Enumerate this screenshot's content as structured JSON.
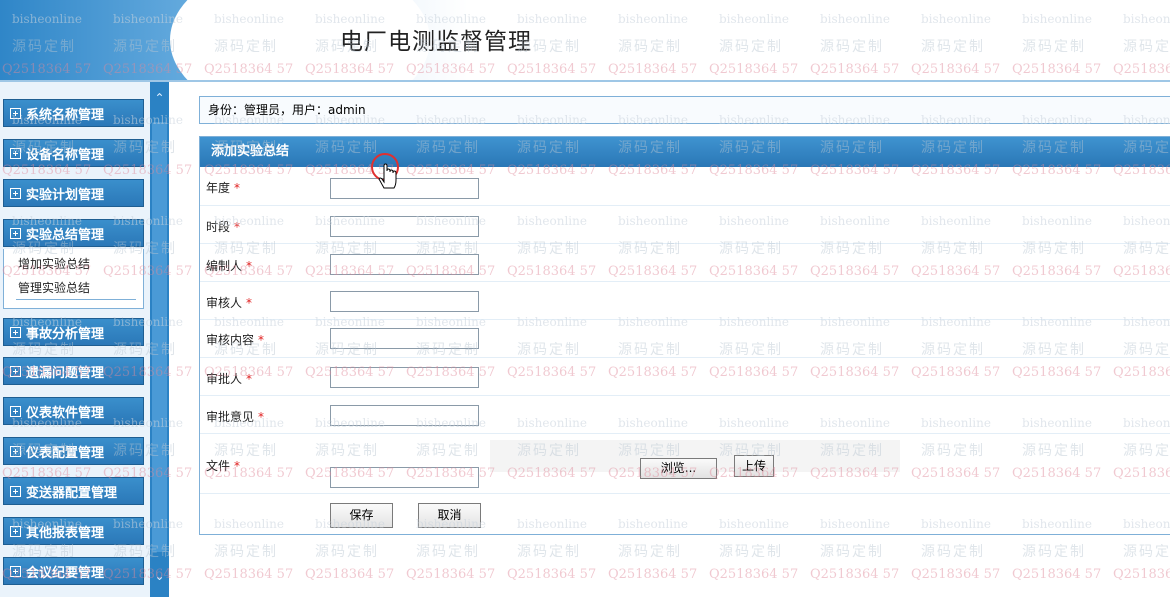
{
  "header": {
    "title": "电厂电测监督管理"
  },
  "watermark": {
    "line1": "bisheonline",
    "line2": "源码定制",
    "line3": "Q2518364 57"
  },
  "sidebar": {
    "items": [
      {
        "label": "系统名称管理"
      },
      {
        "label": "设备名称管理"
      },
      {
        "label": "实验计划管理"
      },
      {
        "label": "实验总结管理",
        "expanded": true
      },
      {
        "label": "事故分析管理"
      },
      {
        "label": "遗漏问题管理"
      },
      {
        "label": "仪表软件管理"
      },
      {
        "label": "仪表配置管理"
      },
      {
        "label": "变送器配置管理"
      },
      {
        "label": "其他报表管理"
      },
      {
        "label": "会议纪要管理"
      }
    ],
    "submenu": [
      {
        "label": "增加实验总结"
      },
      {
        "label": "管理实验总结"
      }
    ]
  },
  "main": {
    "identity": "身份：管理员，用户：admin",
    "form": {
      "title": "添加实验总结",
      "fields": [
        {
          "label": "年度",
          "required": "*"
        },
        {
          "label": "时段",
          "required": "*"
        },
        {
          "label": "编制人",
          "required": "*"
        },
        {
          "label": "审核人",
          "required": "*"
        },
        {
          "label": "审核内容",
          "required": "*"
        },
        {
          "label": "审批人",
          "required": "*"
        },
        {
          "label": "审批意见",
          "required": "*"
        },
        {
          "label": "文件",
          "required": "*"
        }
      ],
      "browse_label": "浏览...",
      "upload_label": "上传",
      "save_label": "保存",
      "cancel_label": "取消"
    }
  },
  "colors": {
    "accent": "#2b78b8",
    "required": "#e02020"
  },
  "cursor": {
    "icon": "hand-pointer-icon"
  }
}
